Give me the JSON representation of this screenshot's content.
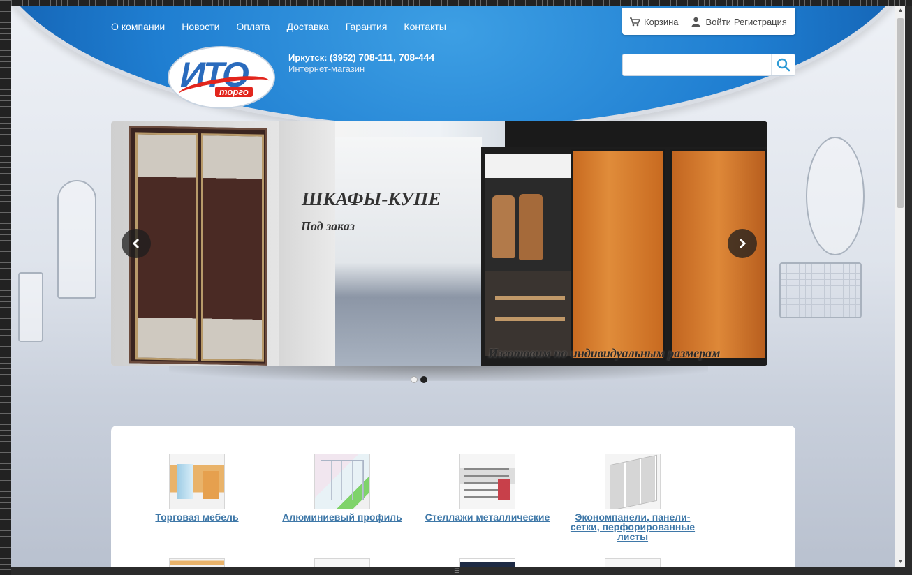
{
  "nav": {
    "items": [
      "О компании",
      "Новости",
      "Оплата",
      "Доставка",
      "Гарантия",
      "Контакты"
    ]
  },
  "logo": {
    "main": "ИТО",
    "sub": "торго"
  },
  "contact": {
    "phone_prefix": "Иркутск: (3952) ",
    "phone_numbers": "708-111, 708-444",
    "subtitle": "Интернет-магазин"
  },
  "userbar": {
    "cart": "Корзина",
    "login": "Войти",
    "register": "Регистрация"
  },
  "search": {
    "placeholder": "",
    "value": ""
  },
  "slider": {
    "title": "ШКАФЫ-КУПЕ",
    "subtitle": "Под заказ",
    "caption": "Изготовим по индивидуальным размерам",
    "active_slide": 2,
    "slide_count": 2
  },
  "catalog": {
    "items": [
      {
        "label": "Торговая мебель"
      },
      {
        "label": "Алюминиевый профиль"
      },
      {
        "label": "Стеллажи металлические"
      },
      {
        "label": "Экономпанели, панели-сетки, перфорированные листы"
      }
    ]
  },
  "colors": {
    "header_blue": "#1f7ed1",
    "link_blue": "#3f78a8",
    "logo_red": "#e2261d"
  }
}
